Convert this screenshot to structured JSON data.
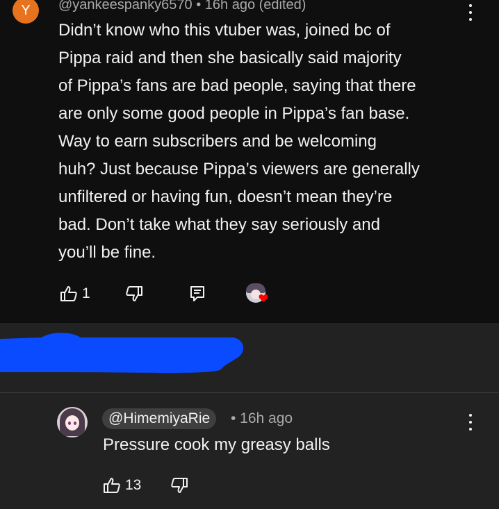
{
  "comment": {
    "avatar_letter": "Y",
    "meta": "@yankeespanky6570 • 16h ago (edited)",
    "lines": [
      "Didn’t know who this vtuber was, joined bc of",
      "Pippa raid and then she basically said majority",
      "of Pippa’s fans are bad people, saying that there",
      "are only some good people in Pippa’s fan base.",
      "Way to earn subscribers and be welcoming",
      "huh? Just because Pippa’s viewers are generally",
      "unfiltered or having fun, doesn’t mean they’re",
      "bad. Don’t take what they say seriously and",
      "you’ll be fine."
    ],
    "like_count": "1",
    "icons": [
      "thumbs-up-icon",
      "thumbs-down-icon",
      "reply-icon",
      "creator-heart-icon",
      "more-vert-icon"
    ]
  },
  "redaction_color": "#0a4bff",
  "reply": {
    "handle": "@HimemiyaRie",
    "meta": "• 16h ago",
    "text": "Pressure cook my greasy balls",
    "like_count": "13",
    "icons": [
      "thumbs-up-icon",
      "thumbs-down-icon",
      "more-vert-icon"
    ]
  },
  "colors": {
    "background": "#0f0f0f",
    "panel": "#222222",
    "avatar_orange": "#e8731f",
    "muted_text": "#aaaaaa",
    "heart_red": "#ff0000"
  }
}
